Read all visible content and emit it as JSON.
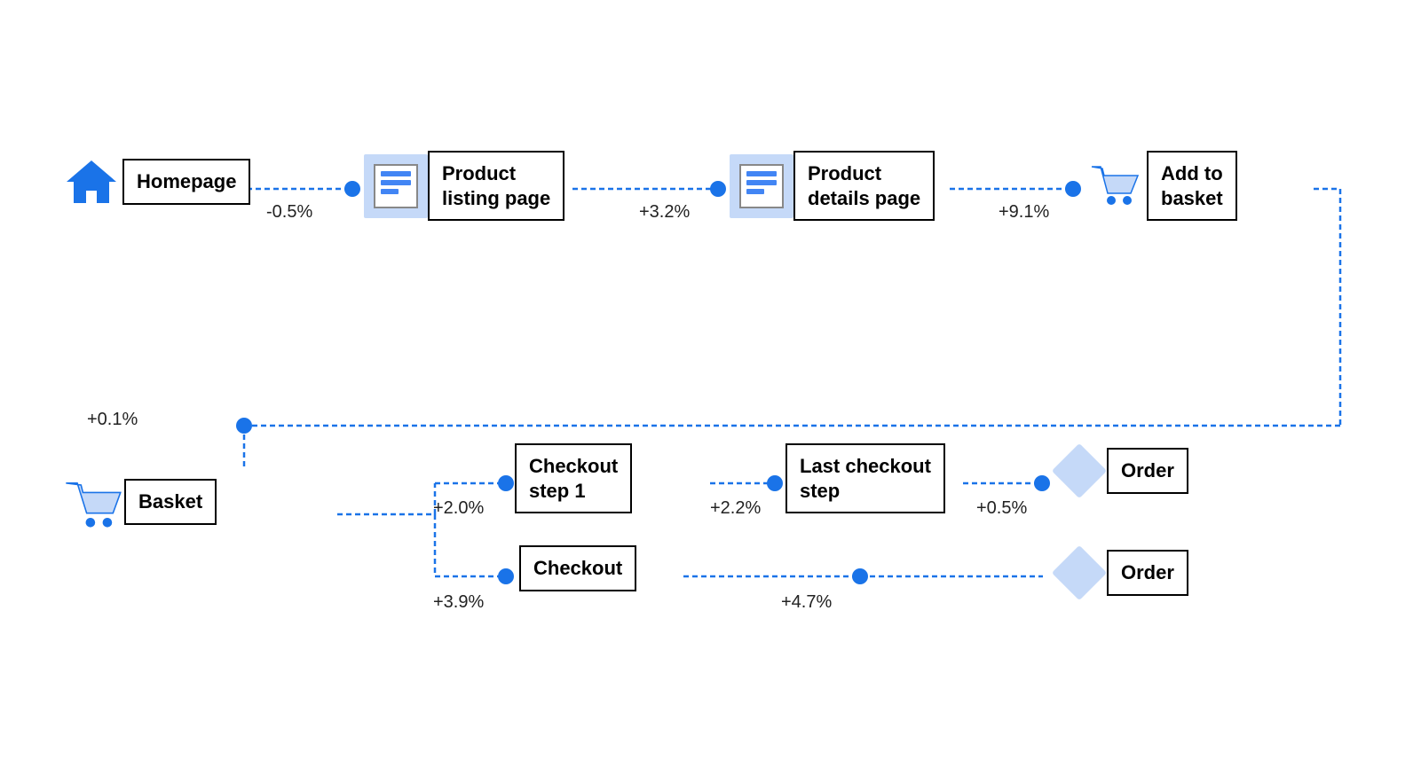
{
  "nodes": {
    "homepage": {
      "label": "Homepage"
    },
    "product_listing": {
      "label": "Product\nlisting page"
    },
    "product_details": {
      "label": "Product\ndetails page"
    },
    "add_to_basket": {
      "label": "Add to\nbasket"
    },
    "basket": {
      "label": "Basket"
    },
    "checkout_step1": {
      "label": "Checkout\nstep 1"
    },
    "last_checkout": {
      "label": "Last checkout\nstep"
    },
    "order1": {
      "label": "Order"
    },
    "checkout": {
      "label": "Checkout"
    },
    "order2": {
      "label": "Order"
    }
  },
  "percentages": {
    "p1": "-0.5%",
    "p2": "+3.2%",
    "p3": "+9.1%",
    "p4": "+0.1%",
    "p5": "+2.0%",
    "p6": "+2.2%",
    "p7": "+0.5%",
    "p8": "+3.9%",
    "p9": "+4.7%"
  },
  "colors": {
    "blue": "#1a73e8",
    "lightBlue": "#c5d9f8",
    "black": "#000",
    "white": "#fff"
  }
}
